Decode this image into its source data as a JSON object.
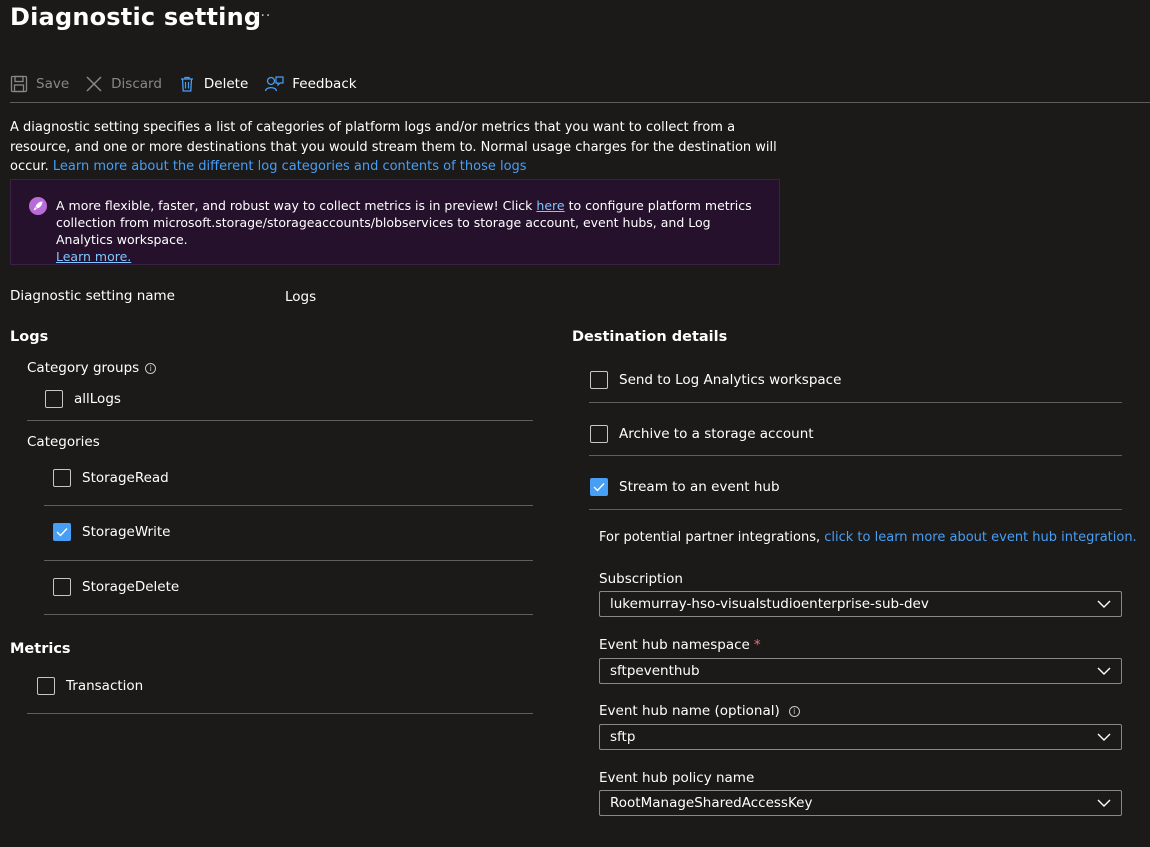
{
  "header": {
    "title": "Diagnostic setting",
    "more": "···"
  },
  "toolbar": {
    "save": "Save",
    "discard": "Discard",
    "delete": "Delete",
    "feedback": "Feedback"
  },
  "description": {
    "text": "A diagnostic setting specifies a list of categories of platform logs and/or metrics that you want to collect from a resource, and one or more destinations that you would stream them to. Normal usage charges for the destination will occur.",
    "link": "Learn more about the different log categories and contents of those logs"
  },
  "banner": {
    "text_before": "A more flexible, faster, and robust way to collect metrics is in preview! Click",
    "link_here": "here",
    "text_after": "to configure platform metrics collection from microsoft.storage/storageaccounts/blobservices to storage account, event hubs, and Log Analytics workspace.",
    "learn_more": "Learn more."
  },
  "setting_name": {
    "label": "Diagnostic setting name",
    "value": "Logs"
  },
  "logs": {
    "heading": "Logs",
    "category_groups_label": "Category groups",
    "all_logs": {
      "label": "allLogs",
      "checked": false
    },
    "categories_label": "Categories",
    "categories": [
      {
        "label": "StorageRead",
        "checked": false
      },
      {
        "label": "StorageWrite",
        "checked": true
      },
      {
        "label": "StorageDelete",
        "checked": false
      }
    ]
  },
  "metrics": {
    "heading": "Metrics",
    "transaction": {
      "label": "Transaction",
      "checked": false
    }
  },
  "destination": {
    "heading": "Destination details",
    "options": [
      {
        "label": "Send to Log Analytics workspace",
        "checked": false
      },
      {
        "label": "Archive to a storage account",
        "checked": false
      },
      {
        "label": "Stream to an event hub",
        "checked": true
      }
    ],
    "partner_text": "For potential partner integrations,",
    "partner_link": "click to learn more about event hub integration.",
    "subscription": {
      "label": "Subscription",
      "value": "lukemurray-hso-visualstudioenterprise-sub-dev"
    },
    "namespace": {
      "label": "Event hub namespace",
      "required": "*",
      "value": "sftpeventhub"
    },
    "hub_name": {
      "label": "Event hub name (optional)",
      "value": "sftp"
    },
    "policy": {
      "label": "Event hub policy name",
      "value": "RootManageSharedAccessKey"
    }
  },
  "colors": {
    "accent": "#479ef5",
    "banner_bg": "#26112c",
    "background": "#1b1a19"
  }
}
